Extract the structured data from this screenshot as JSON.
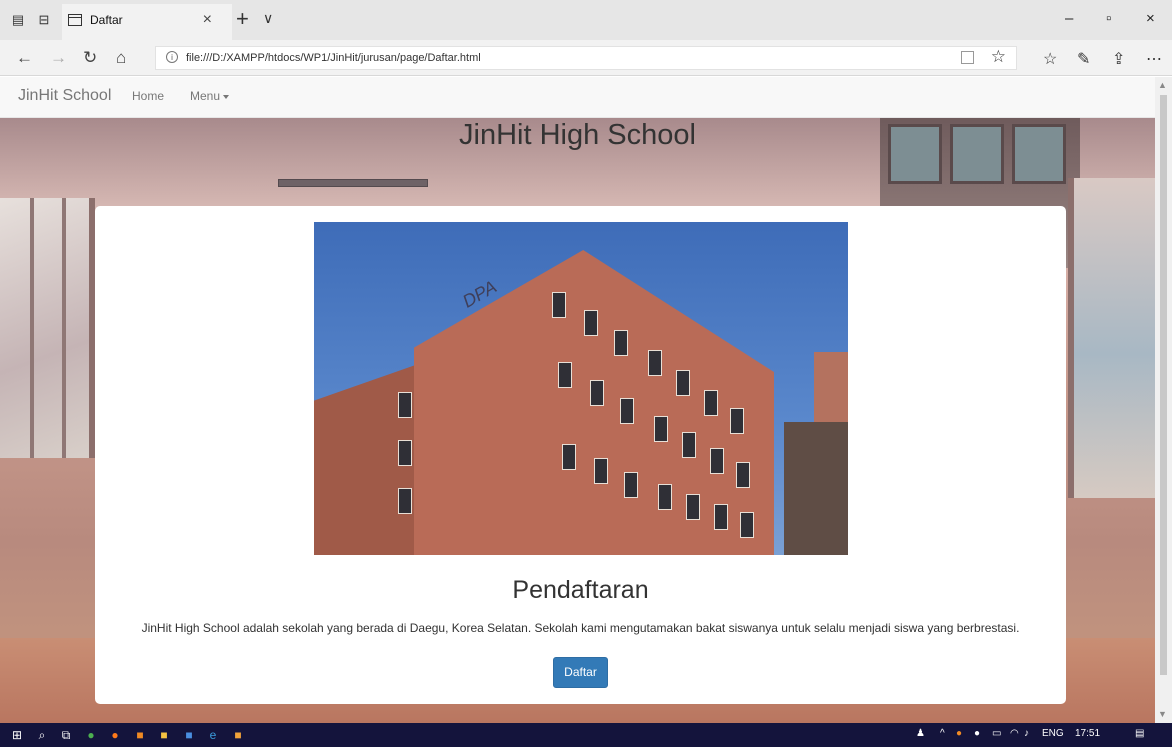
{
  "browser": {
    "tab_title": "Daftar",
    "tab_close": "×",
    "new_tab": "+",
    "tab_menu": "∨",
    "url": "file:///D:/XAMPP/htdocs/WP1/JinHit/jurusan/page/Daftar.html",
    "window_controls": {
      "minimize": "–",
      "maximize": "▫",
      "close": "×"
    },
    "icons": {
      "back": "back-arrow-icon",
      "forward": "forward-arrow-icon",
      "refresh": "refresh-icon",
      "home": "home-icon",
      "favorite": "star-icon",
      "favorites_list": "favorites-list-icon",
      "notes": "pen-icon",
      "share": "share-icon",
      "more": "more-icon"
    }
  },
  "navbar": {
    "brand": "JinHit School",
    "home": "Home",
    "menu": "Menu"
  },
  "page": {
    "heading": "JinHit High School",
    "card": {
      "title": "Pendaftaran",
      "text": "JinHit High School adalah sekolah yang berada di Daegu, Korea Selatan. Sekolah kami mengutamakan bakat siswanya untuk selalu menjadi siswa yang berbrestasi.",
      "button": "Daftar",
      "photo_logo": "DPA"
    }
  },
  "taskbar": {
    "language": "ENG",
    "time": "17:51"
  },
  "colors": {
    "primary_button": "#337ab7",
    "taskbar": "#14143c",
    "navbar": "#f8f8f8"
  }
}
